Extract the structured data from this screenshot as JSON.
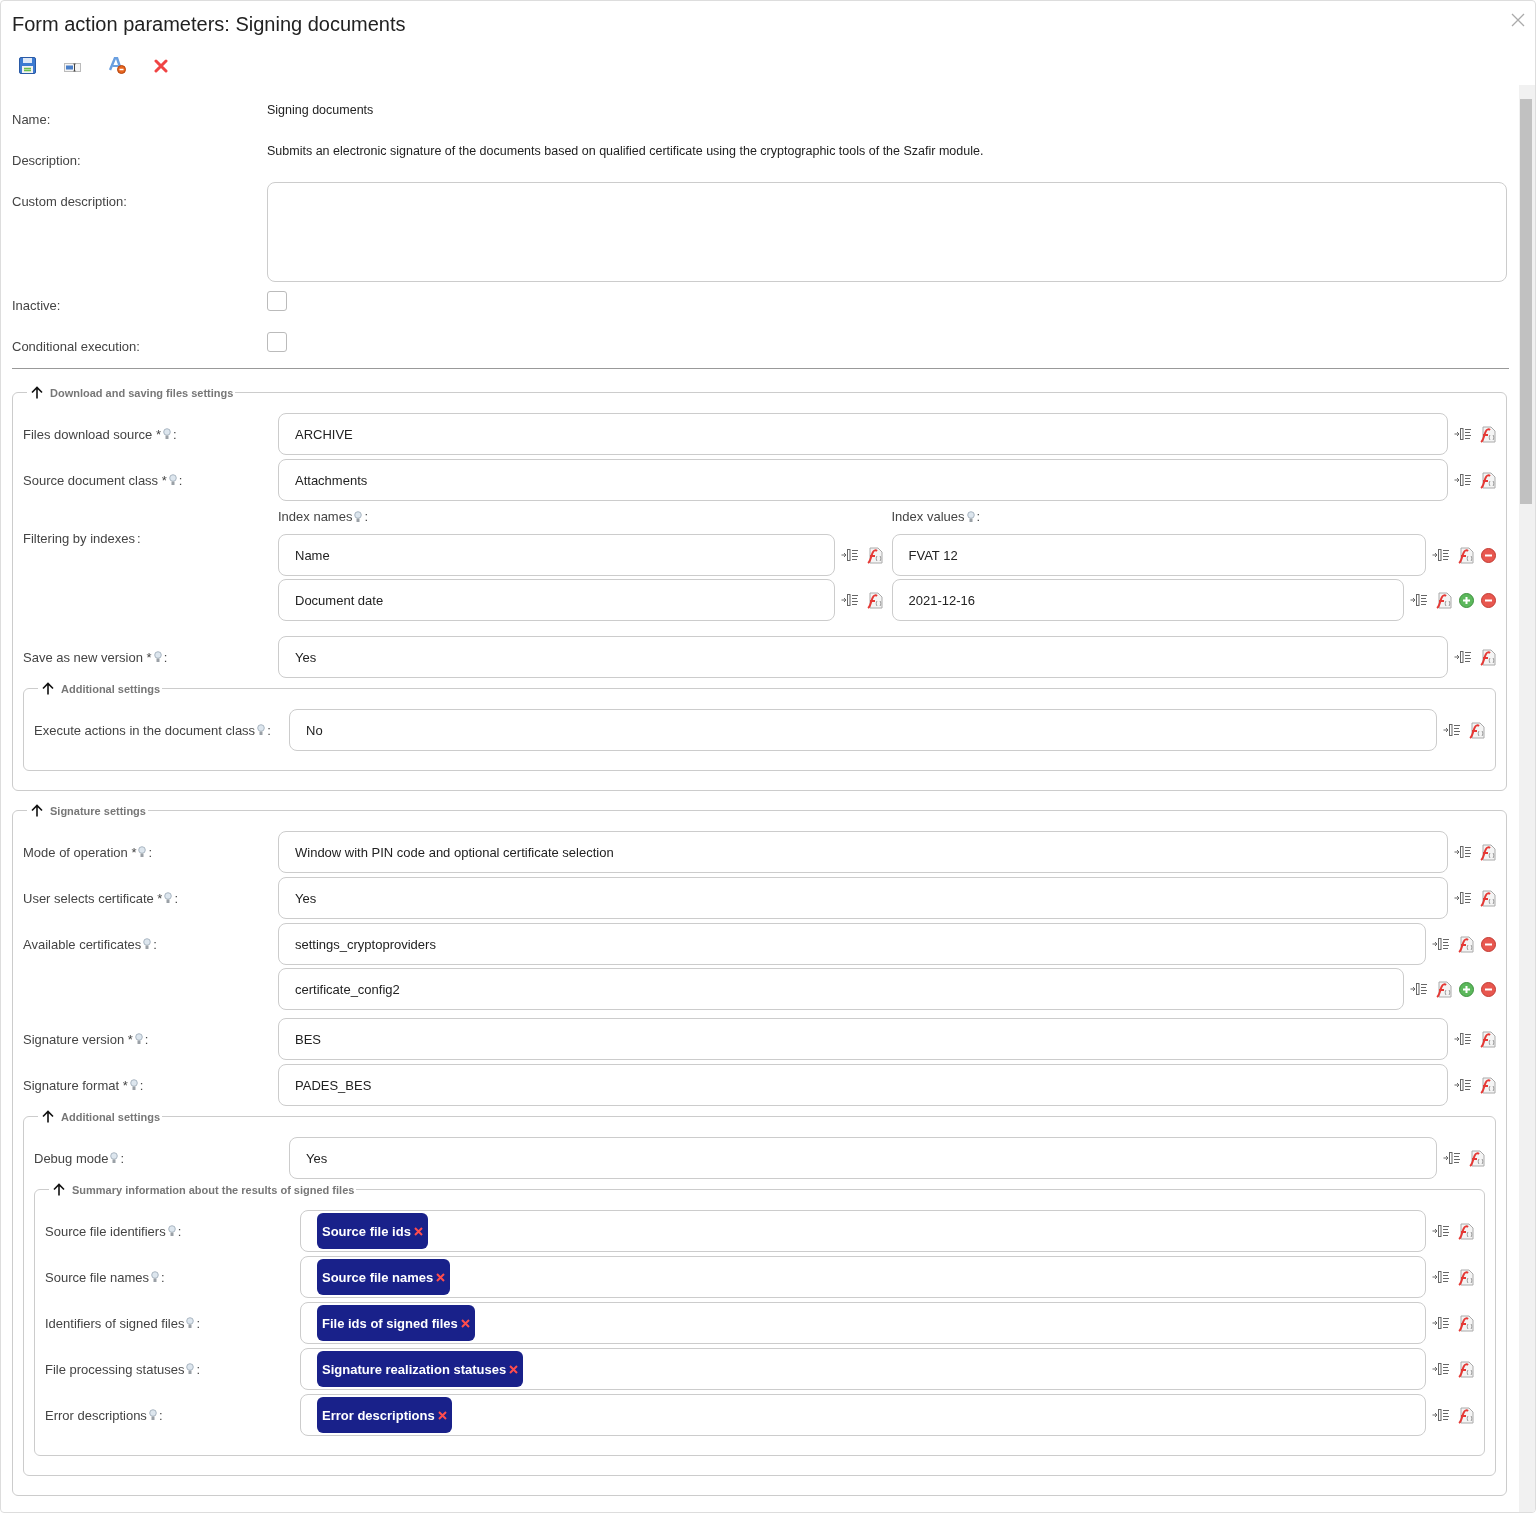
{
  "window": {
    "title": "Form action parameters: Signing documents"
  },
  "toolbar": [
    {
      "kind": "save"
    },
    {
      "kind": "field"
    },
    {
      "kind": "translate"
    },
    {
      "kind": "cancel"
    }
  ],
  "general": [
    {
      "kind": "text",
      "label": "Name:",
      "value": "Signing documents"
    },
    {
      "kind": "text",
      "label": "Description:",
      "value": "Submits an electronic signature of the documents based on qualified certificate using the cryptographic tools of the Szafir module."
    },
    {
      "kind": "textarea",
      "label": "Custom description:"
    },
    {
      "kind": "checkbox",
      "label": "Inactive:",
      "checked": false
    },
    {
      "kind": "checkbox",
      "label": "Conditional execution:",
      "checked": false
    }
  ],
  "sections": [
    {
      "title": "Download and saving files settings",
      "expanded": true,
      "rows": [
        {
          "kind": "select",
          "label": "Files download source *",
          "hint": true,
          "colon": ":",
          "value": "ARCHIVE"
        },
        {
          "kind": "select",
          "label": "Source document class *",
          "hint": true,
          "colon": ":",
          "value": "Attachments"
        },
        {
          "kind": "index_filter",
          "label": "Filtering by indexes",
          "hint": false,
          "colon": ":",
          "names_header": {
            "label": "Index names",
            "hint": true,
            "colon": ":"
          },
          "values_header": {
            "label": "Index values",
            "hint": true,
            "colon": ":"
          },
          "pairs": [
            {
              "name": "Name",
              "value": "FVAT 12"
            },
            {
              "name": "Document date",
              "value": "2021-12-16"
            }
          ]
        },
        {
          "kind": "select",
          "label": "Save as new version *",
          "hint": true,
          "colon": ":",
          "value": "Yes"
        },
        {
          "kind": "section",
          "title": "Additional settings",
          "expanded": true,
          "rows": [
            {
              "kind": "select",
              "label": "Execute actions in the document class",
              "hint": true,
              "colon": ":",
              "value": "No"
            }
          ]
        }
      ]
    },
    {
      "title": "Signature settings",
      "expanded": true,
      "rows": [
        {
          "kind": "select",
          "label": "Mode of operation *",
          "hint": true,
          "colon": ":",
          "value": "Window with PIN code and optional certificate selection"
        },
        {
          "kind": "select",
          "label": "User selects certificate *",
          "hint": true,
          "colon": ":",
          "value": "Yes"
        },
        {
          "kind": "multi",
          "label": "Available certificates",
          "hint": true,
          "colon": ":",
          "values": [
            "settings_cryptoproviders",
            "certificate_config2"
          ]
        },
        {
          "kind": "select",
          "label": "Signature version *",
          "hint": true,
          "colon": ":",
          "value": "BES"
        },
        {
          "kind": "select",
          "label": "Signature format *",
          "hint": true,
          "colon": ":",
          "value": "PADES_BES"
        },
        {
          "kind": "section",
          "title": "Additional settings",
          "expanded": true,
          "rows": [
            {
              "kind": "select",
              "label": "Debug mode",
              "hint": true,
              "colon": ":",
              "value": "Yes"
            },
            {
              "kind": "section",
              "title": "Summary information about the results of signed files",
              "expanded": true,
              "rows": [
                {
                  "kind": "tags",
                  "label": "Source file identifiers",
                  "hint": true,
                  "colon": ":",
                  "tags": [
                    "Source file ids"
                  ]
                },
                {
                  "kind": "tags",
                  "label": "Source file names",
                  "hint": true,
                  "colon": ":",
                  "tags": [
                    "Source file names"
                  ]
                },
                {
                  "kind": "tags",
                  "label": "Identifiers of signed files",
                  "hint": true,
                  "colon": ":",
                  "tags": [
                    "File ids of signed files"
                  ]
                },
                {
                  "kind": "tags",
                  "label": "File processing statuses",
                  "hint": true,
                  "colon": ":",
                  "tags": [
                    "Signature realization statuses"
                  ]
                },
                {
                  "kind": "tags",
                  "label": "Error descriptions",
                  "hint": true,
                  "colon": ":",
                  "tags": [
                    "Error descriptions"
                  ]
                }
              ]
            }
          ]
        }
      ]
    }
  ]
}
